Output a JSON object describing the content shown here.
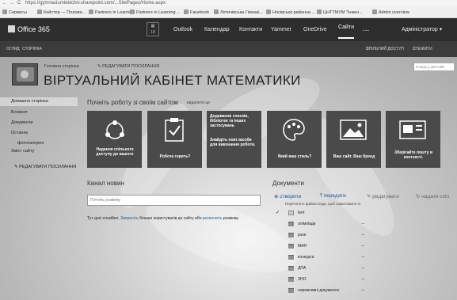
{
  "browser": {
    "back": "←",
    "forward": "→",
    "reload": "C",
    "url": "https://gymnasiumlebichiv.sharepoint.com/...SitePages/Home.aspx",
    "bookmarks": [
      "Сервисы",
      "Кейстер — Полови...",
      "Partners in Learning",
      "Partners in Learning ...",
      "Facebook",
      "Летичівська Гімназі...",
      "Носівська районна ...",
      "ЦНТТМУМ \"Інжен...",
      "Admin overview"
    ]
  },
  "suite": {
    "brand": "Office 365",
    "waffle_count": "18",
    "nav": [
      "Outlook",
      "Календар",
      "Контакти",
      "Yammer",
      "OneDrive",
      "Сайти",
      "..."
    ],
    "user": "Адміністратор ▾",
    "icons": [
      "bell-icon",
      "gear-icon",
      "help-icon"
    ]
  },
  "ribbon": {
    "tabs": [
      "ОГЛЯД",
      "СТОРІНКА"
    ],
    "share": "СПІЛЬНИЙ ДОСТУП",
    "follow": "СТЕЖИТИ"
  },
  "site": {
    "breadcrumb": "Головна сторінка",
    "edit_links": "РЕДАГУВАТИ ПОСИЛАННЯ",
    "title": "ВІРТУАЛЬНИЙ КАБІНЕТ МАТЕМАТИКИ",
    "search_placeholder": "Пошук у цей сайт"
  },
  "leftnav": {
    "items": [
      "Домашня сторінка",
      "Блокнот",
      "Документи",
      "Останнє",
      "фотогалерея",
      "Зміст сайту"
    ],
    "edit_links": "РЕДАГУВАТИ ПОСИЛАННЯ"
  },
  "getting_started": {
    "title": "Почніть роботу зі своїм сайтом",
    "remove": "видалити це",
    "tiles": [
      {
        "label": "Надання спільного доступу до вашого",
        "icon": "share-icon"
      },
      {
        "label": "Робота горить?",
        "icon": "clipboard-check-icon"
      },
      {
        "label": "Додавання списків, бібліотек та інших застосувань",
        "label2": "Знайдіть нові засоби для виконання роботи.",
        "icon": "none"
      },
      {
        "label": "Який ваш стиль?",
        "icon": "palette-icon"
      },
      {
        "label": "Ваш сайт. Ваш бренд",
        "icon": "picture-icon"
      },
      {
        "label": "Зберігайте пошту в контексті.",
        "icon": "mail-icon"
      }
    ]
  },
  "news": {
    "title": "Канал новин",
    "placeholder": "Почніть розмову",
    "empty_pre": "Тут досі спокійно.",
    "empty_link1": "Запросіть",
    "empty_mid": "більше користувачів до сайту або",
    "empty_link2": "розпочніть",
    "empty_post": "розмову."
  },
  "documents": {
    "title": "Документи",
    "create": "⊕ створити",
    "upload": "⤒ передати",
    "edit": "✎ редагувати",
    "share": "↻ надати спіл",
    "drop_hint": "Перетягніть файли сюди, щоб завантажити їх",
    "header": "Ім'я",
    "items": [
      "олімпіади",
      "рзне",
      "МАН",
      "конкурси",
      "ДПА",
      "ЗНО",
      "нормативні документи"
    ],
    "more": "..."
  }
}
